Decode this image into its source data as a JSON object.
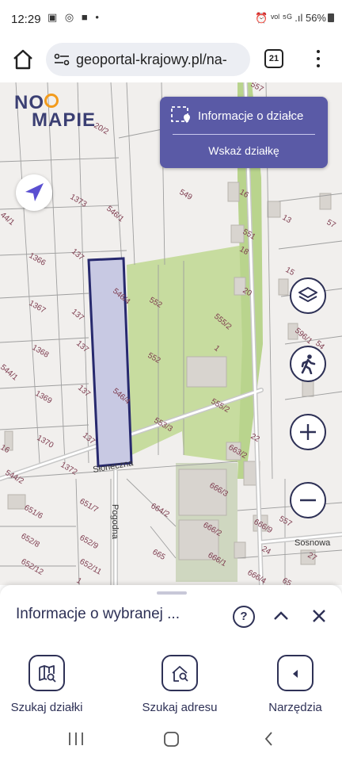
{
  "status_bar": {
    "time": "12:29",
    "left_icons": "▣ ◎ ■ •",
    "right_text": "⏰ ᵛᵒˡ ⁵ᴳ .ıl 56%"
  },
  "browser": {
    "url": "geoportal-krajowy.pl/na-",
    "tab_count": "21"
  },
  "map": {
    "logo_line1": "NO",
    "logo_line2": "MAPIE",
    "info_panel_title": "Informacje o działce",
    "info_panel_action": "Wskaż działkę",
    "parcel_labels": [
      "557",
      "20/2",
      "1373",
      "546/1",
      "549",
      "16",
      "551",
      "18",
      "13",
      "57",
      "44/1",
      "1366",
      "137",
      "20",
      "15",
      "552",
      "546/4",
      "1367",
      "137",
      "555/2",
      "596/1",
      "137",
      "1",
      "1368",
      "552",
      "54",
      "544/1",
      "137",
      "546/4",
      "555/2",
      "1369",
      "553/3",
      "137",
      "663/2",
      "22",
      "1370",
      "16",
      "1372",
      "666/3",
      "544/2",
      "651/6",
      "651/7",
      "664/2",
      "666/9",
      "557",
      "652/8",
      "652/9",
      "666/2",
      "24",
      "27",
      "665",
      "652/11",
      "666/1",
      "652/12",
      "666/4",
      "1",
      "65"
    ],
    "street_labels": [
      "Słoneczna",
      "Pogodna",
      "Sosnowa"
    ],
    "colors": {
      "parcel_fill": "#c8c9e3",
      "parcel_border": "#27296e",
      "accent": "#5a5aa6"
    }
  },
  "sheet": {
    "title": "Informacje o wybranej ...",
    "help_glyph": "?"
  },
  "toolbar": {
    "search_parcel": "Szukaj działki",
    "search_address": "Szukaj adresu",
    "tools": "Narzędzia"
  }
}
